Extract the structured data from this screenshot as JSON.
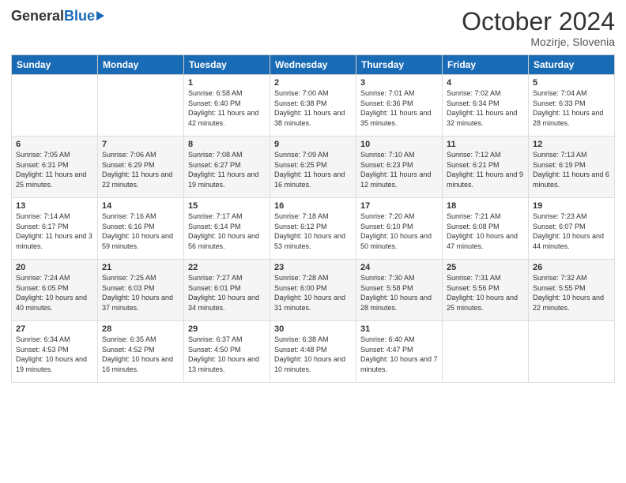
{
  "header": {
    "logo_general": "General",
    "logo_blue": "Blue",
    "month_title": "October 2024",
    "location": "Mozirje, Slovenia"
  },
  "weekdays": [
    "Sunday",
    "Monday",
    "Tuesday",
    "Wednesday",
    "Thursday",
    "Friday",
    "Saturday"
  ],
  "weeks": [
    [
      {
        "day": "",
        "sunrise": "",
        "sunset": "",
        "daylight": ""
      },
      {
        "day": "",
        "sunrise": "",
        "sunset": "",
        "daylight": ""
      },
      {
        "day": "1",
        "sunrise": "Sunrise: 6:58 AM",
        "sunset": "Sunset: 6:40 PM",
        "daylight": "Daylight: 11 hours and 42 minutes."
      },
      {
        "day": "2",
        "sunrise": "Sunrise: 7:00 AM",
        "sunset": "Sunset: 6:38 PM",
        "daylight": "Daylight: 11 hours and 38 minutes."
      },
      {
        "day": "3",
        "sunrise": "Sunrise: 7:01 AM",
        "sunset": "Sunset: 6:36 PM",
        "daylight": "Daylight: 11 hours and 35 minutes."
      },
      {
        "day": "4",
        "sunrise": "Sunrise: 7:02 AM",
        "sunset": "Sunset: 6:34 PM",
        "daylight": "Daylight: 11 hours and 32 minutes."
      },
      {
        "day": "5",
        "sunrise": "Sunrise: 7:04 AM",
        "sunset": "Sunset: 6:33 PM",
        "daylight": "Daylight: 11 hours and 28 minutes."
      }
    ],
    [
      {
        "day": "6",
        "sunrise": "Sunrise: 7:05 AM",
        "sunset": "Sunset: 6:31 PM",
        "daylight": "Daylight: 11 hours and 25 minutes."
      },
      {
        "day": "7",
        "sunrise": "Sunrise: 7:06 AM",
        "sunset": "Sunset: 6:29 PM",
        "daylight": "Daylight: 11 hours and 22 minutes."
      },
      {
        "day": "8",
        "sunrise": "Sunrise: 7:08 AM",
        "sunset": "Sunset: 6:27 PM",
        "daylight": "Daylight: 11 hours and 19 minutes."
      },
      {
        "day": "9",
        "sunrise": "Sunrise: 7:09 AM",
        "sunset": "Sunset: 6:25 PM",
        "daylight": "Daylight: 11 hours and 16 minutes."
      },
      {
        "day": "10",
        "sunrise": "Sunrise: 7:10 AM",
        "sunset": "Sunset: 6:23 PM",
        "daylight": "Daylight: 11 hours and 12 minutes."
      },
      {
        "day": "11",
        "sunrise": "Sunrise: 7:12 AM",
        "sunset": "Sunset: 6:21 PM",
        "daylight": "Daylight: 11 hours and 9 minutes."
      },
      {
        "day": "12",
        "sunrise": "Sunrise: 7:13 AM",
        "sunset": "Sunset: 6:19 PM",
        "daylight": "Daylight: 11 hours and 6 minutes."
      }
    ],
    [
      {
        "day": "13",
        "sunrise": "Sunrise: 7:14 AM",
        "sunset": "Sunset: 6:17 PM",
        "daylight": "Daylight: 11 hours and 3 minutes."
      },
      {
        "day": "14",
        "sunrise": "Sunrise: 7:16 AM",
        "sunset": "Sunset: 6:16 PM",
        "daylight": "Daylight: 10 hours and 59 minutes."
      },
      {
        "day": "15",
        "sunrise": "Sunrise: 7:17 AM",
        "sunset": "Sunset: 6:14 PM",
        "daylight": "Daylight: 10 hours and 56 minutes."
      },
      {
        "day": "16",
        "sunrise": "Sunrise: 7:18 AM",
        "sunset": "Sunset: 6:12 PM",
        "daylight": "Daylight: 10 hours and 53 minutes."
      },
      {
        "day": "17",
        "sunrise": "Sunrise: 7:20 AM",
        "sunset": "Sunset: 6:10 PM",
        "daylight": "Daylight: 10 hours and 50 minutes."
      },
      {
        "day": "18",
        "sunrise": "Sunrise: 7:21 AM",
        "sunset": "Sunset: 6:08 PM",
        "daylight": "Daylight: 10 hours and 47 minutes."
      },
      {
        "day": "19",
        "sunrise": "Sunrise: 7:23 AM",
        "sunset": "Sunset: 6:07 PM",
        "daylight": "Daylight: 10 hours and 44 minutes."
      }
    ],
    [
      {
        "day": "20",
        "sunrise": "Sunrise: 7:24 AM",
        "sunset": "Sunset: 6:05 PM",
        "daylight": "Daylight: 10 hours and 40 minutes."
      },
      {
        "day": "21",
        "sunrise": "Sunrise: 7:25 AM",
        "sunset": "Sunset: 6:03 PM",
        "daylight": "Daylight: 10 hours and 37 minutes."
      },
      {
        "day": "22",
        "sunrise": "Sunrise: 7:27 AM",
        "sunset": "Sunset: 6:01 PM",
        "daylight": "Daylight: 10 hours and 34 minutes."
      },
      {
        "day": "23",
        "sunrise": "Sunrise: 7:28 AM",
        "sunset": "Sunset: 6:00 PM",
        "daylight": "Daylight: 10 hours and 31 minutes."
      },
      {
        "day": "24",
        "sunrise": "Sunrise: 7:30 AM",
        "sunset": "Sunset: 5:58 PM",
        "daylight": "Daylight: 10 hours and 28 minutes."
      },
      {
        "day": "25",
        "sunrise": "Sunrise: 7:31 AM",
        "sunset": "Sunset: 5:56 PM",
        "daylight": "Daylight: 10 hours and 25 minutes."
      },
      {
        "day": "26",
        "sunrise": "Sunrise: 7:32 AM",
        "sunset": "Sunset: 5:55 PM",
        "daylight": "Daylight: 10 hours and 22 minutes."
      }
    ],
    [
      {
        "day": "27",
        "sunrise": "Sunrise: 6:34 AM",
        "sunset": "Sunset: 4:53 PM",
        "daylight": "Daylight: 10 hours and 19 minutes."
      },
      {
        "day": "28",
        "sunrise": "Sunrise: 6:35 AM",
        "sunset": "Sunset: 4:52 PM",
        "daylight": "Daylight: 10 hours and 16 minutes."
      },
      {
        "day": "29",
        "sunrise": "Sunrise: 6:37 AM",
        "sunset": "Sunset: 4:50 PM",
        "daylight": "Daylight: 10 hours and 13 minutes."
      },
      {
        "day": "30",
        "sunrise": "Sunrise: 6:38 AM",
        "sunset": "Sunset: 4:48 PM",
        "daylight": "Daylight: 10 hours and 10 minutes."
      },
      {
        "day": "31",
        "sunrise": "Sunrise: 6:40 AM",
        "sunset": "Sunset: 4:47 PM",
        "daylight": "Daylight: 10 hours and 7 minutes."
      },
      {
        "day": "",
        "sunrise": "",
        "sunset": "",
        "daylight": ""
      },
      {
        "day": "",
        "sunrise": "",
        "sunset": "",
        "daylight": ""
      }
    ]
  ]
}
